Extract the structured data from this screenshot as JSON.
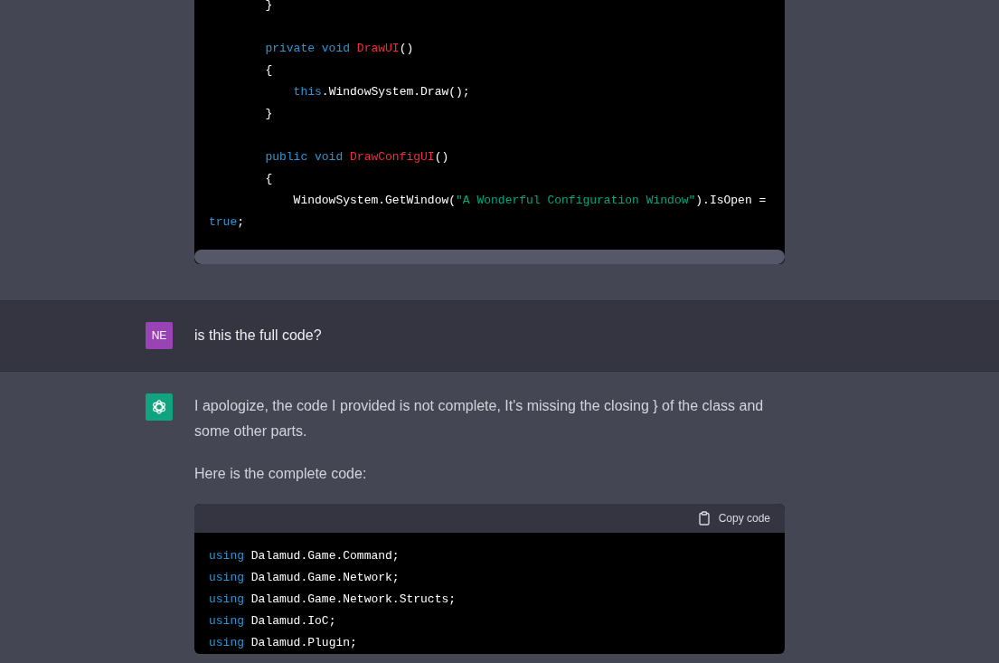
{
  "earlier_code": {
    "lines": [
      {
        "kind": "code",
        "tokens": [
          {
            "kind": "plain",
            "text": "        }"
          }
        ]
      },
      {
        "kind": "blank"
      },
      {
        "kind": "code",
        "tokens": [
          {
            "kind": "kw",
            "text": "        private void "
          },
          {
            "kind": "fn",
            "text": "DrawUI"
          },
          {
            "kind": "plain",
            "text": "()"
          }
        ]
      },
      {
        "kind": "code",
        "tokens": [
          {
            "kind": "plain",
            "text": "        {"
          }
        ]
      },
      {
        "kind": "code",
        "tokens": [
          {
            "kind": "kw",
            "text": "            this"
          },
          {
            "kind": "plain",
            "text": ".WindowSystem.Draw();"
          }
        ]
      },
      {
        "kind": "code",
        "tokens": [
          {
            "kind": "plain",
            "text": "        }"
          }
        ]
      },
      {
        "kind": "blank"
      },
      {
        "kind": "code",
        "tokens": [
          {
            "kind": "kw",
            "text": "        public void "
          },
          {
            "kind": "fn",
            "text": "DrawConfigUI"
          },
          {
            "kind": "plain",
            "text": "()"
          }
        ]
      },
      {
        "kind": "code",
        "tokens": [
          {
            "kind": "plain",
            "text": "        {"
          }
        ]
      },
      {
        "kind": "code",
        "tokens": [
          {
            "kind": "plain",
            "text": "            WindowSystem.GetWindow("
          },
          {
            "kind": "str",
            "text": "\"A Wonderful Configuration Window\""
          },
          {
            "kind": "plain",
            "text": ").IsOpen ="
          }
        ]
      },
      {
        "kind": "code",
        "tokens": [
          {
            "kind": "kw",
            "text": "true"
          },
          {
            "kind": "plain",
            "text": ";"
          }
        ]
      }
    ]
  },
  "messages": [
    {
      "kind": "user",
      "avatar": "NE",
      "text": "is this the full code?"
    },
    {
      "kind": "assistant",
      "paragraphs": [
        "I apologize, the code I provided is not complete, It's missing the closing } of the class and some other parts.",
        "Here is the complete code:"
      ],
      "code": {
        "copy_label": "Copy code",
        "lines": [
          {
            "kind": "code",
            "tokens": [
              {
                "kind": "kw",
                "text": "using"
              },
              {
                "kind": "plain",
                "text": " Dalamud.Game.Command;"
              }
            ]
          },
          {
            "kind": "code",
            "tokens": [
              {
                "kind": "kw",
                "text": "using"
              },
              {
                "kind": "plain",
                "text": " Dalamud.Game.Network;"
              }
            ]
          },
          {
            "kind": "code",
            "tokens": [
              {
                "kind": "kw",
                "text": "using"
              },
              {
                "kind": "plain",
                "text": " Dalamud.Game.Network.Structs;"
              }
            ]
          },
          {
            "kind": "code",
            "tokens": [
              {
                "kind": "kw",
                "text": "using"
              },
              {
                "kind": "plain",
                "text": " Dalamud.IoC;"
              }
            ]
          },
          {
            "kind": "code",
            "tokens": [
              {
                "kind": "kw",
                "text": "using"
              },
              {
                "kind": "plain",
                "text": " Dalamud.Plugin;"
              }
            ]
          }
        ]
      }
    }
  ]
}
